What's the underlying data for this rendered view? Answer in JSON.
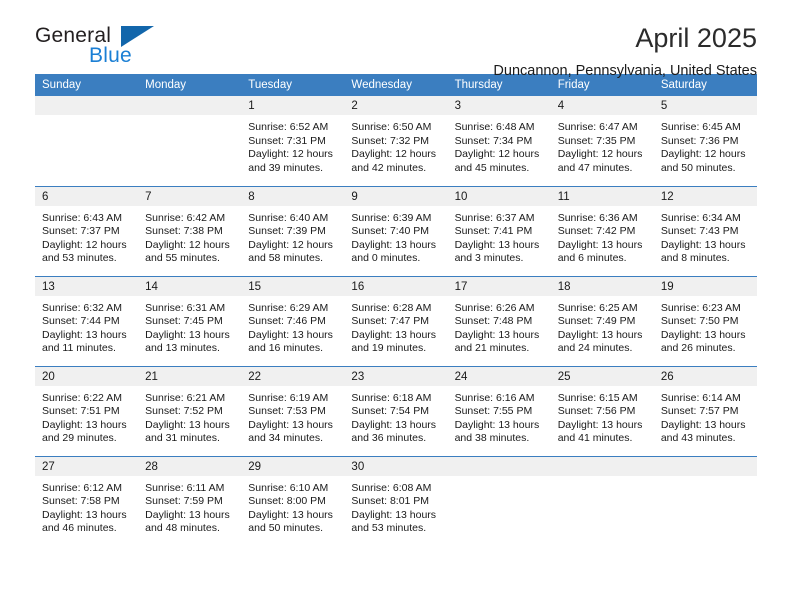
{
  "brand": {
    "name_part1": "General",
    "name_part2": "Blue",
    "accent_color": "#1b7fd4",
    "triangle_color": "#1266ab"
  },
  "header": {
    "title": "April 2025",
    "location": "Duncannon, Pennsylvania, United States"
  },
  "calendar": {
    "header_bg": "#3b7ec0",
    "day_band_bg": "#f0f0f0",
    "weekday_headers": [
      "Sunday",
      "Monday",
      "Tuesday",
      "Wednesday",
      "Thursday",
      "Friday",
      "Saturday"
    ],
    "labels": {
      "sunrise": "Sunrise:",
      "sunset": "Sunset:",
      "daylight": "Daylight:"
    },
    "weeks": [
      [
        {
          "day": "",
          "empty": true
        },
        {
          "day": "",
          "empty": true
        },
        {
          "day": "1",
          "sunrise": "Sunrise: 6:52 AM",
          "sunset": "Sunset: 7:31 PM",
          "daylight_line1": "Daylight: 12 hours",
          "daylight_line2": "and 39 minutes."
        },
        {
          "day": "2",
          "sunrise": "Sunrise: 6:50 AM",
          "sunset": "Sunset: 7:32 PM",
          "daylight_line1": "Daylight: 12 hours",
          "daylight_line2": "and 42 minutes."
        },
        {
          "day": "3",
          "sunrise": "Sunrise: 6:48 AM",
          "sunset": "Sunset: 7:34 PM",
          "daylight_line1": "Daylight: 12 hours",
          "daylight_line2": "and 45 minutes."
        },
        {
          "day": "4",
          "sunrise": "Sunrise: 6:47 AM",
          "sunset": "Sunset: 7:35 PM",
          "daylight_line1": "Daylight: 12 hours",
          "daylight_line2": "and 47 minutes."
        },
        {
          "day": "5",
          "sunrise": "Sunrise: 6:45 AM",
          "sunset": "Sunset: 7:36 PM",
          "daylight_line1": "Daylight: 12 hours",
          "daylight_line2": "and 50 minutes."
        }
      ],
      [
        {
          "day": "6",
          "sunrise": "Sunrise: 6:43 AM",
          "sunset": "Sunset: 7:37 PM",
          "daylight_line1": "Daylight: 12 hours",
          "daylight_line2": "and 53 minutes."
        },
        {
          "day": "7",
          "sunrise": "Sunrise: 6:42 AM",
          "sunset": "Sunset: 7:38 PM",
          "daylight_line1": "Daylight: 12 hours",
          "daylight_line2": "and 55 minutes."
        },
        {
          "day": "8",
          "sunrise": "Sunrise: 6:40 AM",
          "sunset": "Sunset: 7:39 PM",
          "daylight_line1": "Daylight: 12 hours",
          "daylight_line2": "and 58 minutes."
        },
        {
          "day": "9",
          "sunrise": "Sunrise: 6:39 AM",
          "sunset": "Sunset: 7:40 PM",
          "daylight_line1": "Daylight: 13 hours",
          "daylight_line2": "and 0 minutes."
        },
        {
          "day": "10",
          "sunrise": "Sunrise: 6:37 AM",
          "sunset": "Sunset: 7:41 PM",
          "daylight_line1": "Daylight: 13 hours",
          "daylight_line2": "and 3 minutes."
        },
        {
          "day": "11",
          "sunrise": "Sunrise: 6:36 AM",
          "sunset": "Sunset: 7:42 PM",
          "daylight_line1": "Daylight: 13 hours",
          "daylight_line2": "and 6 minutes."
        },
        {
          "day": "12",
          "sunrise": "Sunrise: 6:34 AM",
          "sunset": "Sunset: 7:43 PM",
          "daylight_line1": "Daylight: 13 hours",
          "daylight_line2": "and 8 minutes."
        }
      ],
      [
        {
          "day": "13",
          "sunrise": "Sunrise: 6:32 AM",
          "sunset": "Sunset: 7:44 PM",
          "daylight_line1": "Daylight: 13 hours",
          "daylight_line2": "and 11 minutes."
        },
        {
          "day": "14",
          "sunrise": "Sunrise: 6:31 AM",
          "sunset": "Sunset: 7:45 PM",
          "daylight_line1": "Daylight: 13 hours",
          "daylight_line2": "and 13 minutes."
        },
        {
          "day": "15",
          "sunrise": "Sunrise: 6:29 AM",
          "sunset": "Sunset: 7:46 PM",
          "daylight_line1": "Daylight: 13 hours",
          "daylight_line2": "and 16 minutes."
        },
        {
          "day": "16",
          "sunrise": "Sunrise: 6:28 AM",
          "sunset": "Sunset: 7:47 PM",
          "daylight_line1": "Daylight: 13 hours",
          "daylight_line2": "and 19 minutes."
        },
        {
          "day": "17",
          "sunrise": "Sunrise: 6:26 AM",
          "sunset": "Sunset: 7:48 PM",
          "daylight_line1": "Daylight: 13 hours",
          "daylight_line2": "and 21 minutes."
        },
        {
          "day": "18",
          "sunrise": "Sunrise: 6:25 AM",
          "sunset": "Sunset: 7:49 PM",
          "daylight_line1": "Daylight: 13 hours",
          "daylight_line2": "and 24 minutes."
        },
        {
          "day": "19",
          "sunrise": "Sunrise: 6:23 AM",
          "sunset": "Sunset: 7:50 PM",
          "daylight_line1": "Daylight: 13 hours",
          "daylight_line2": "and 26 minutes."
        }
      ],
      [
        {
          "day": "20",
          "sunrise": "Sunrise: 6:22 AM",
          "sunset": "Sunset: 7:51 PM",
          "daylight_line1": "Daylight: 13 hours",
          "daylight_line2": "and 29 minutes."
        },
        {
          "day": "21",
          "sunrise": "Sunrise: 6:21 AM",
          "sunset": "Sunset: 7:52 PM",
          "daylight_line1": "Daylight: 13 hours",
          "daylight_line2": "and 31 minutes."
        },
        {
          "day": "22",
          "sunrise": "Sunrise: 6:19 AM",
          "sunset": "Sunset: 7:53 PM",
          "daylight_line1": "Daylight: 13 hours",
          "daylight_line2": "and 34 minutes."
        },
        {
          "day": "23",
          "sunrise": "Sunrise: 6:18 AM",
          "sunset": "Sunset: 7:54 PM",
          "daylight_line1": "Daylight: 13 hours",
          "daylight_line2": "and 36 minutes."
        },
        {
          "day": "24",
          "sunrise": "Sunrise: 6:16 AM",
          "sunset": "Sunset: 7:55 PM",
          "daylight_line1": "Daylight: 13 hours",
          "daylight_line2": "and 38 minutes."
        },
        {
          "day": "25",
          "sunrise": "Sunrise: 6:15 AM",
          "sunset": "Sunset: 7:56 PM",
          "daylight_line1": "Daylight: 13 hours",
          "daylight_line2": "and 41 minutes."
        },
        {
          "day": "26",
          "sunrise": "Sunrise: 6:14 AM",
          "sunset": "Sunset: 7:57 PM",
          "daylight_line1": "Daylight: 13 hours",
          "daylight_line2": "and 43 minutes."
        }
      ],
      [
        {
          "day": "27",
          "sunrise": "Sunrise: 6:12 AM",
          "sunset": "Sunset: 7:58 PM",
          "daylight_line1": "Daylight: 13 hours",
          "daylight_line2": "and 46 minutes."
        },
        {
          "day": "28",
          "sunrise": "Sunrise: 6:11 AM",
          "sunset": "Sunset: 7:59 PM",
          "daylight_line1": "Daylight: 13 hours",
          "daylight_line2": "and 48 minutes."
        },
        {
          "day": "29",
          "sunrise": "Sunrise: 6:10 AM",
          "sunset": "Sunset: 8:00 PM",
          "daylight_line1": "Daylight: 13 hours",
          "daylight_line2": "and 50 minutes."
        },
        {
          "day": "30",
          "sunrise": "Sunrise: 6:08 AM",
          "sunset": "Sunset: 8:01 PM",
          "daylight_line1": "Daylight: 13 hours",
          "daylight_line2": "and 53 minutes."
        },
        {
          "day": "",
          "empty": true
        },
        {
          "day": "",
          "empty": true
        },
        {
          "day": "",
          "empty": true
        }
      ]
    ]
  }
}
